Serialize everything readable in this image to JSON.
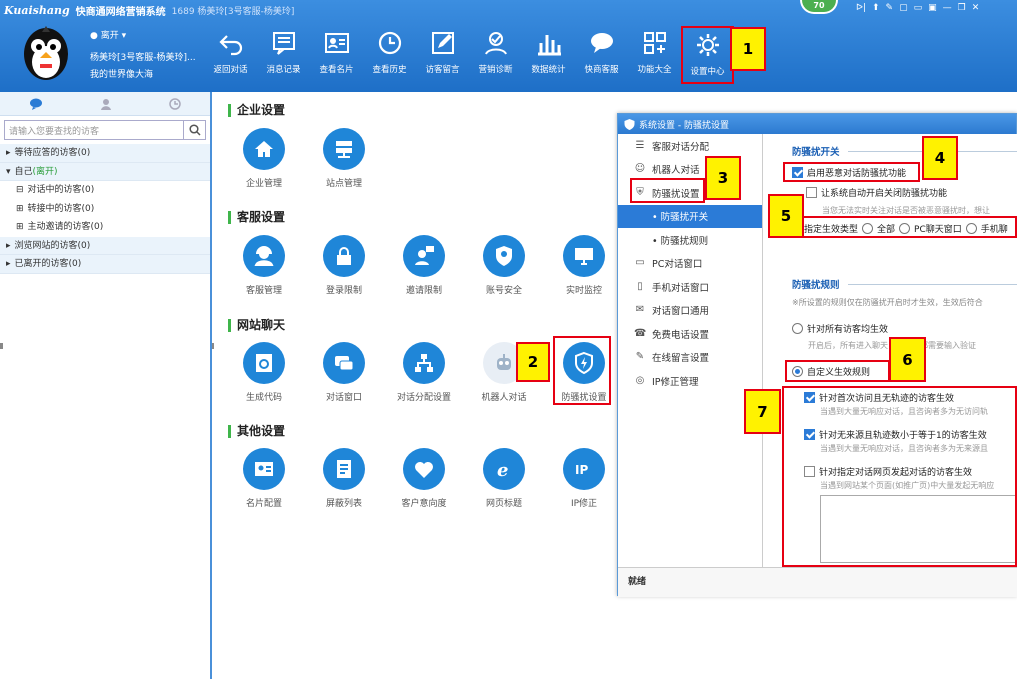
{
  "app": {
    "logo": "Kuaishang",
    "title": "快商通网络营销系统",
    "info": "1689 杨美玲[3号客服-杨美玲]",
    "score": "70"
  },
  "window_controls": [
    "ᐅ|",
    "⬆",
    "✎",
    "▢",
    "▭",
    "▣",
    "—",
    "❐",
    "✕"
  ],
  "user": {
    "status": "离开",
    "name": "杨美玲[3号客服-杨美玲]...",
    "motto": "我的世界像大海"
  },
  "toolbar": [
    {
      "label": "返回对话",
      "icon": "back-arrow-icon"
    },
    {
      "label": "消息记录",
      "icon": "message-record-icon"
    },
    {
      "label": "查看名片",
      "icon": "business-card-icon"
    },
    {
      "label": "查看历史",
      "icon": "history-clock-icon"
    },
    {
      "label": "访客留言",
      "icon": "edit-note-icon"
    },
    {
      "label": "营销诊断",
      "icon": "diagnosis-icon"
    },
    {
      "label": "数据统计",
      "icon": "bar-chart-icon"
    },
    {
      "label": "快商客服",
      "icon": "chat-bubble-icon"
    },
    {
      "label": "功能大全",
      "icon": "grid-icon"
    },
    {
      "label": "设置中心",
      "icon": "gear-icon"
    }
  ],
  "sidebar": {
    "search_placeholder": "请输入您要查找的访客",
    "tree": [
      {
        "label": "等待应答的访客(0)",
        "level": 0,
        "toggle": "▸"
      },
      {
        "label": "自己",
        "suffix": "(离开)",
        "level": 0,
        "toggle": "▾"
      },
      {
        "label": "对话中的访客(0)",
        "level": 1,
        "toggle": "⊟"
      },
      {
        "label": "转接中的访客(0)",
        "level": 1,
        "toggle": "⊞"
      },
      {
        "label": "主动邀请的访客(0)",
        "level": 1,
        "toggle": "⊞"
      },
      {
        "label": "浏览网站的访客(0)",
        "level": 0,
        "toggle": "▸"
      },
      {
        "label": "已离开的访客(0)",
        "level": 0,
        "toggle": "▸"
      }
    ]
  },
  "settings": {
    "sections": [
      {
        "title": "企业设置",
        "items": [
          {
            "label": "企业管理",
            "icon": "home-icon"
          },
          {
            "label": "站点管理",
            "icon": "server-icon"
          }
        ]
      },
      {
        "title": "客服设置",
        "items": [
          {
            "label": "客服管理",
            "icon": "agent-icon"
          },
          {
            "label": "登录限制",
            "icon": "lock-icon"
          },
          {
            "label": "邀请限制",
            "icon": "invite-person-icon"
          },
          {
            "label": "账号安全",
            "icon": "shield-user-icon"
          },
          {
            "label": "实时监控",
            "icon": "monitor-icon"
          }
        ]
      },
      {
        "title": "网站聊天",
        "items": [
          {
            "label": "生成代码",
            "icon": "code-page-icon"
          },
          {
            "label": "对话窗口",
            "icon": "chat-window-icon"
          },
          {
            "label": "对话分配设置",
            "icon": "org-chart-icon"
          },
          {
            "label": "机器人对话",
            "icon": "robot-icon"
          },
          {
            "label": "防骚扰设置",
            "icon": "shield-bolt-icon"
          }
        ]
      },
      {
        "title": "其他设置",
        "items": [
          {
            "label": "名片配置",
            "icon": "id-card-icon"
          },
          {
            "label": "屏蔽列表",
            "icon": "block-list-icon"
          },
          {
            "label": "客户意向度",
            "icon": "heart-icon"
          },
          {
            "label": "网页标题",
            "icon": "ie-browser-icon"
          },
          {
            "label": "IP修正",
            "icon": "ip-icon"
          }
        ]
      }
    ]
  },
  "dialog": {
    "title": "系统设置 - 防骚扰设置",
    "nav": [
      {
        "label": "客服对话分配",
        "icon": "list-icon",
        "sub": false
      },
      {
        "label": "机器人对话",
        "icon": "robot-icon",
        "sub": false
      },
      {
        "label": "防骚扰设置",
        "icon": "shield-icon",
        "sub": false
      },
      {
        "label": "• 防骚扰开关",
        "icon": "",
        "sub": true,
        "selected": true
      },
      {
        "label": "• 防骚扰规则",
        "icon": "",
        "sub": true
      },
      {
        "label": "PC对话窗口",
        "icon": "pc-icon",
        "sub": false
      },
      {
        "label": "手机对话窗口",
        "icon": "mobile-icon",
        "sub": false
      },
      {
        "label": "对话窗口通用",
        "icon": "chat-icon",
        "sub": false
      },
      {
        "label": "免费电话设置",
        "icon": "phone-icon",
        "sub": false
      },
      {
        "label": "在线留言设置",
        "icon": "edit-icon",
        "sub": false
      },
      {
        "label": "IP修正管理",
        "icon": "location-icon",
        "sub": false
      }
    ],
    "switch_group": {
      "title": "防骚扰开关",
      "enable_label": "启用恶意对话防骚扰功能",
      "enable_checked": true,
      "auto_label": "让系统自动开启关闭防骚扰功能",
      "auto_checked": false,
      "auto_hint": "当您无法实时关注对话是否被恶意骚扰时，想让",
      "type_label": "指定生效类型",
      "type_options": [
        "全部",
        "PC聊天窗口",
        "手机聊"
      ]
    },
    "rule_group": {
      "title": "防骚扰规则",
      "note": "※所设置的规则仅在防骚扰开启时才生效，生效后符合",
      "all_label": "针对所有访客均生效",
      "all_hint": "开启后，所有进入聊天　　访客都需要输入验证",
      "custom_label": "自定义生效规则",
      "custom_selected": true,
      "rules": [
        {
          "label": "针对首次访问且无轨迹的访客生效",
          "checked": true,
          "hint": "当遇到大量无响应对话，且咨询者多为无访问轨"
        },
        {
          "label": "针对无来源且轨迹数小于等于1的访客生效",
          "checked": true,
          "hint": "当遇到大量无响应对话，且咨询者多为无来源且"
        },
        {
          "label": "针对指定对话网页发起对话的访客生效",
          "checked": false,
          "hint": "当遇到网站某个页面(如推广页)中大量发起无响应"
        }
      ]
    },
    "status": "就绪"
  },
  "callouts": [
    "1",
    "2",
    "3",
    "4",
    "5",
    "6",
    "7"
  ],
  "colors": {
    "brand": "#1f86d8",
    "highlight": "#e60012",
    "callout": "#fff200",
    "section_bar": "#3fb54b"
  }
}
